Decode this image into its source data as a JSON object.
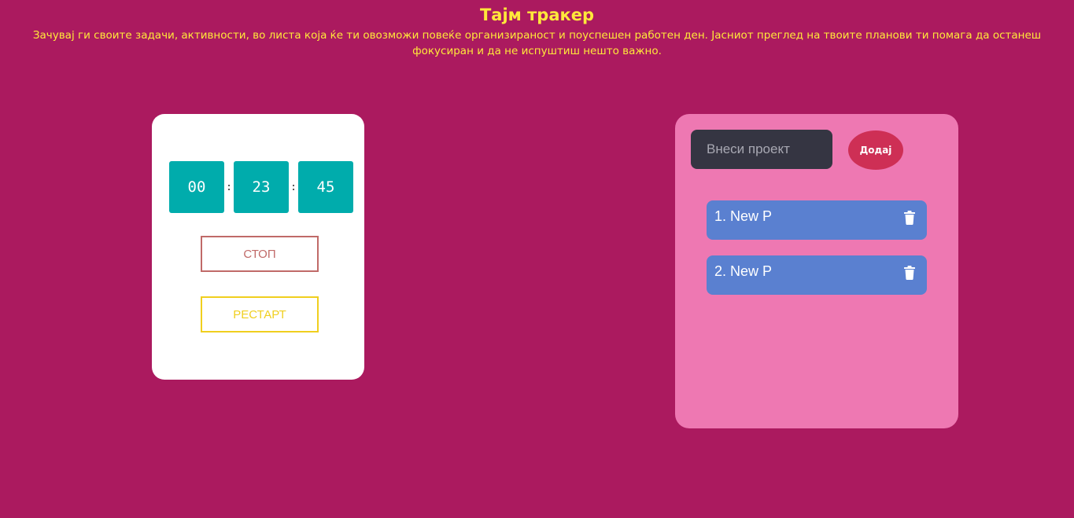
{
  "header": {
    "title": "Тајм тракер",
    "subtitle": "Зачувај ги своите задачи, активности, во листа која ќе ти овозможи повеќе организираност и поуспешен работен ден. Јасниот преглед на твоите планови ти помага да останеш фокусиран и да не испуштиш нешто важно."
  },
  "timer": {
    "hours": "00",
    "minutes": "23",
    "seconds": "45",
    "separator": ":",
    "stop_label": "СТОП",
    "restart_label": "РЕСТАРТ"
  },
  "projects": {
    "input_placeholder": "Внеси проект",
    "input_value": "",
    "add_label": "Додај",
    "items": [
      {
        "label": "1. New P",
        "icon": "trash-icon"
      },
      {
        "label": "2. New P",
        "icon": "trash-icon"
      }
    ]
  },
  "colors": {
    "background": "#ab1a5f",
    "header_text": "#ffe83a",
    "timer_box": "#00acac",
    "stop_button": "#c06a68",
    "restart_button": "#f0cf1e",
    "project_card": "#ee78b2",
    "input_bg": "#353542",
    "add_button": "#ce2f55",
    "project_item": "#5a80d0"
  }
}
